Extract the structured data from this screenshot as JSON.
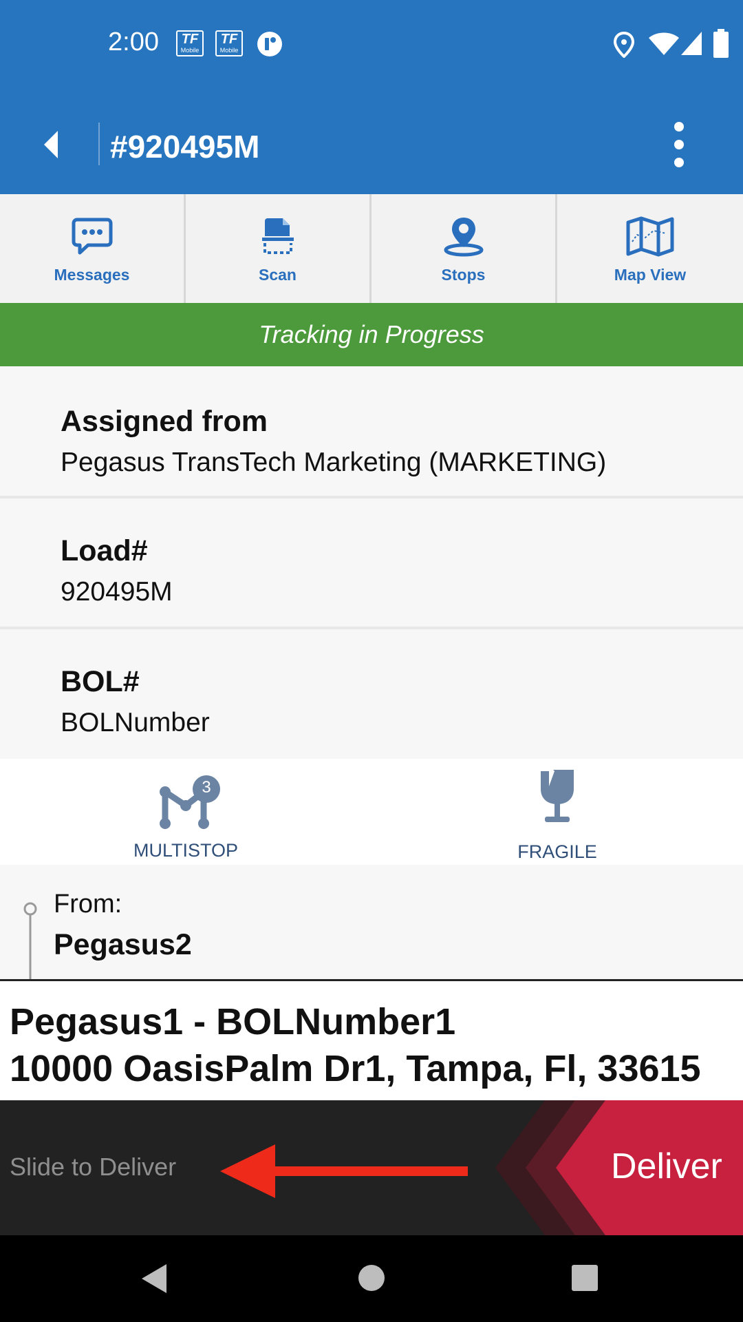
{
  "status_bar": {
    "time": "2:00",
    "notification_icons": [
      "tf-mobile-icon",
      "tf-mobile-icon",
      "circle-app-icon"
    ],
    "system_icons": [
      "location-icon",
      "wifi-icon",
      "signal-icon",
      "battery-icon"
    ]
  },
  "app_bar": {
    "title": "#920495M",
    "back_icon": "chevron-left-icon",
    "menu_icon": "more-vert-icon"
  },
  "toolbar": {
    "items": [
      {
        "label": "Messages",
        "icon": "chat-icon"
      },
      {
        "label": "Scan",
        "icon": "scan-icon"
      },
      {
        "label": "Stops",
        "icon": "map-pin-icon"
      },
      {
        "label": "Map View",
        "icon": "map-icon"
      }
    ]
  },
  "banner": {
    "text": "Tracking in Progress"
  },
  "cards": [
    {
      "heading": "Assigned from",
      "value": "Pegasus TransTech Marketing (MARKETING)"
    },
    {
      "heading": "Load#",
      "value": "920495M"
    },
    {
      "heading": "BOL#",
      "value": "BOLNumber"
    }
  ],
  "flags": [
    {
      "label": "MULTISTOP",
      "badge": "3",
      "icon": "multistop-icon"
    },
    {
      "label": "FRAGILE",
      "icon": "fragile-glass-icon"
    }
  ],
  "route": {
    "from_label": "From:",
    "from_name": "Pegasus2"
  },
  "destination": {
    "line1": "Pegasus1 - BOLNumber1",
    "line2": "10000 OasisPalm Dr1, Tampa, Fl, 33615"
  },
  "slider": {
    "hint": "Slide to Deliver",
    "action_label": "Deliver",
    "action_color": "#c8213f"
  },
  "nav_bar": {
    "buttons": [
      "back-triangle-icon",
      "home-circle-icon",
      "recents-square-icon"
    ]
  },
  "colors": {
    "primary": "#2775bf",
    "tracking": "#4c9a3b",
    "deliver": "#c8213f",
    "arrow": "#ee2a1a"
  }
}
